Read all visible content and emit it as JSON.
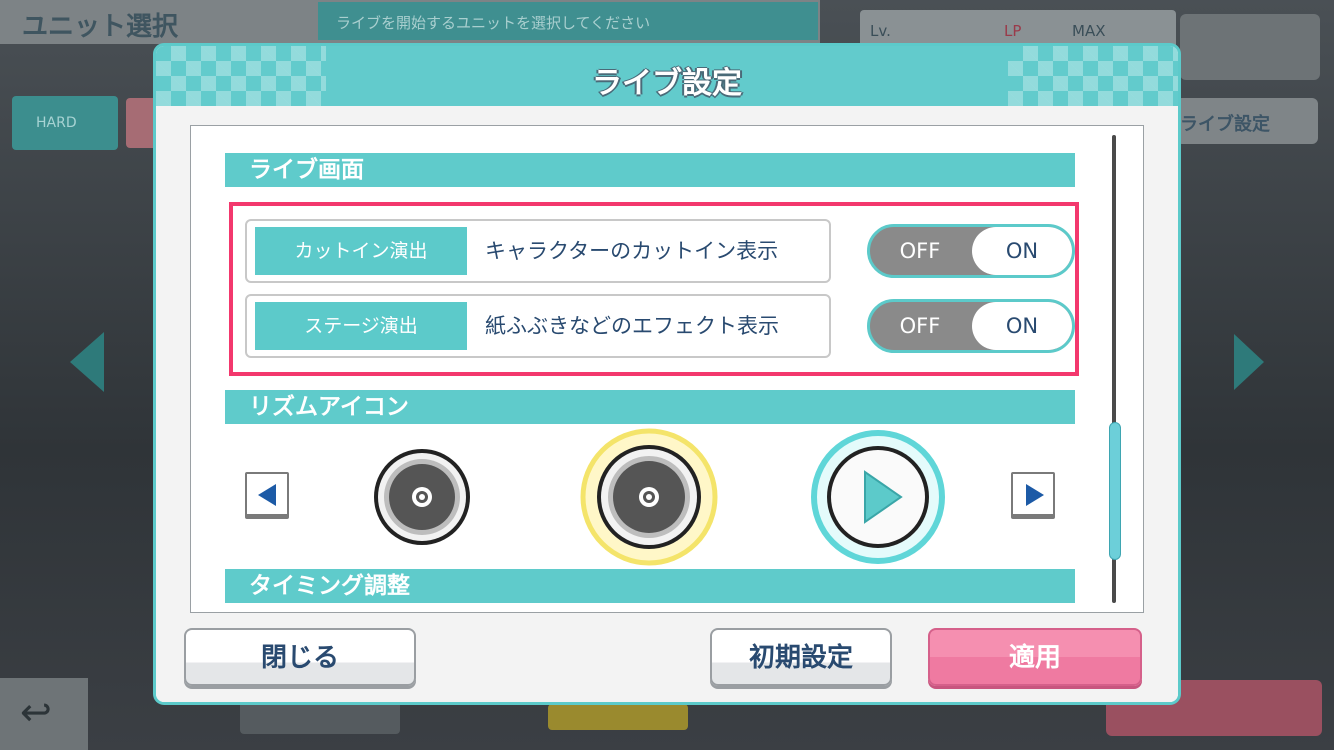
{
  "background": {
    "screen_title": "ユニット選択",
    "screen_hint": "ライブを開始するユニットを選択してください",
    "status": {
      "lv_label": "Lv.",
      "lp_label": "LP",
      "max_label": "MAX"
    },
    "difficulty": "HARD",
    "live_settings_button": "ライブ設定"
  },
  "dialog": {
    "title": "ライブ設定",
    "sections": {
      "live_screen": "ライブ画面",
      "rhythm_icon": "リズムアイコン",
      "timing": "タイミング調整"
    },
    "settings": [
      {
        "tag": "カットイン演出",
        "description": "キャラクターのカットイン表示",
        "off_label": "OFF",
        "on_label": "ON",
        "value": "ON"
      },
      {
        "tag": "ステージ演出",
        "description": "紙ふぶきなどのエフェクト表示",
        "off_label": "OFF",
        "on_label": "ON",
        "value": "ON"
      }
    ],
    "rhythm_icons": [
      {
        "icon": "circle-note-icon",
        "selected": false
      },
      {
        "icon": "circle-note-icon",
        "selected": true
      },
      {
        "icon": "play-note-icon",
        "selected": false
      }
    ],
    "buttons": {
      "close": "閉じる",
      "reset": "初期設定",
      "apply": "適用"
    }
  },
  "colors": {
    "accent": "#5ccaca",
    "highlight_frame": "#f3386d",
    "apply_button": "#ef7aa1",
    "text_dark": "#294a70"
  }
}
